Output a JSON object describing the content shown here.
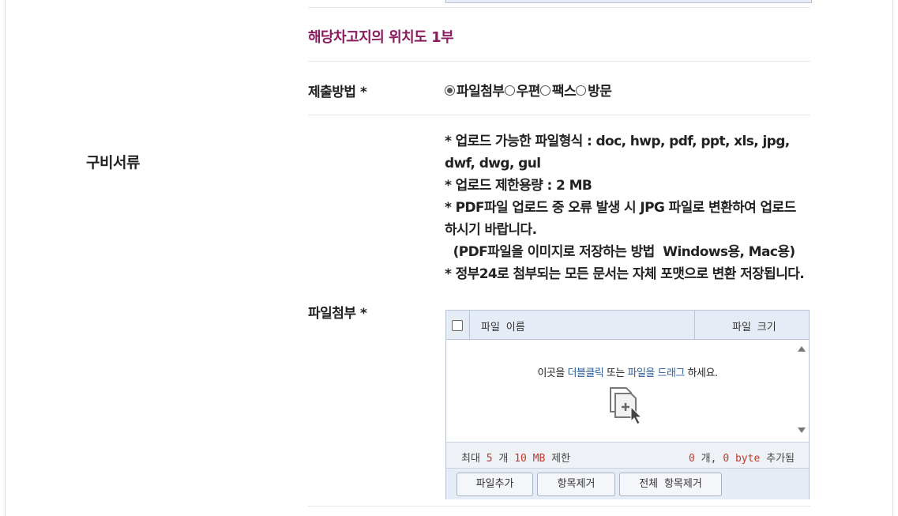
{
  "section": {
    "label": "구비서류"
  },
  "document": {
    "title": "해당차고지의 위치도 1부"
  },
  "submit_method": {
    "label": "제출방법 *",
    "options": [
      "파일첨부",
      "우편",
      "팩스",
      "방문"
    ],
    "selected": "파일첨부"
  },
  "attachment": {
    "label": "파일첨부 *",
    "notes": [
      "* 업로드 가능한 파일형식 : doc, hwp, pdf, ppt, xls, jpg, dwf, dwg, gul",
      "* 업로드 제한용량 : 2 MB",
      "* PDF파일 업로드 중 오류 발생 시 JPG 파일로 변환하여 업로드 하시기 바랍니다.",
      "  (PDF파일을 이미지로 저장하는 방법  Windows용, Mac용)",
      "* 정부24로 첨부되는 모든 문서는 자체 포맷으로 변환 저장됩니다."
    ]
  },
  "uploader": {
    "col_name": "파일 이름",
    "col_size": "파일 크기",
    "hint": {
      "p1": "이곳을 ",
      "p2": "더블클릭",
      "p3": " 또는 ",
      "p4": "파일을 드래그",
      "p5": " 하세요."
    },
    "status_left": {
      "p1": "최대 ",
      "count": "5",
      "p2": " 개 ",
      "size": "10 MB",
      "p3": " 제한"
    },
    "status_right": {
      "count": "0",
      "p1": " 개, ",
      "bytes": "0 byte",
      "p2": " 추가됨"
    },
    "buttons": {
      "add": "파일추가",
      "remove": "항목제거",
      "remove_all": "전체 항목제거"
    }
  },
  "colors": {
    "title": "#8b1a5e",
    "link": "#2a5c9a",
    "accent_red": "#c0392b",
    "panel": "#e6ecf5",
    "border": "#b9c4d6"
  },
  "icons": [
    "radio-selected-icon",
    "radio-icon",
    "checkbox-icon",
    "file-add-icon",
    "scroll-up-icon",
    "scroll-down-icon"
  ]
}
